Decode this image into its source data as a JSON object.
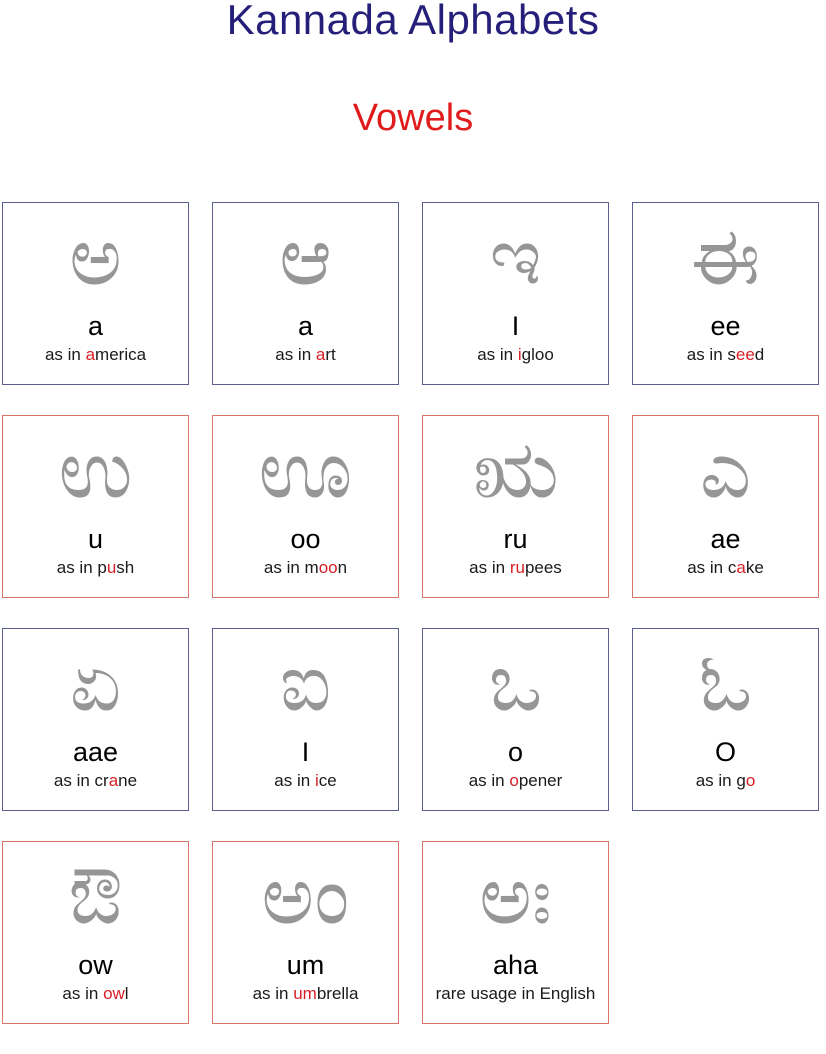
{
  "header": {
    "title": "Kannada Alphabets",
    "subtitle": "Vowels",
    "title_color": "#251f7a",
    "subtitle_color": "#e01b1b"
  },
  "colors": {
    "glyph_gray": "#969696",
    "border_navy": "#5a5f8f",
    "border_red": "#d9766b",
    "highlight_red": "#d81f26",
    "text_black": "#000000",
    "background": "#ffffff"
  },
  "chart_data": {
    "type": "table",
    "title": "Kannada Alphabets",
    "subtitle": "Vowels",
    "columns": 4,
    "rows": 4,
    "cells": 15
  },
  "rows": [
    {
      "border": "navy",
      "cells": [
        {
          "glyph": "ಅ",
          "roman": "a",
          "example_pre": "as in ",
          "example_hl": "a",
          "example_post": "merica"
        },
        {
          "glyph": "ಆ",
          "roman": "a",
          "example_pre": "as in ",
          "example_hl": "a",
          "example_post": "rt"
        },
        {
          "glyph": "ಇ",
          "roman": "I",
          "example_pre": "as in ",
          "example_hl": "i",
          "example_post": "gloo"
        },
        {
          "glyph": "ಈ",
          "roman": "ee",
          "example_pre": "as in s",
          "example_hl": "ee",
          "example_post": "d"
        }
      ]
    },
    {
      "border": "red",
      "cells": [
        {
          "glyph": "ಉ",
          "roman": "u",
          "example_pre": "as in p",
          "example_hl": "u",
          "example_post": "sh"
        },
        {
          "glyph": "ಊ",
          "roman": "oo",
          "example_pre": "as in m",
          "example_hl": "oo",
          "example_post": "n"
        },
        {
          "glyph": "ಋ",
          "roman": "ru",
          "example_pre": "as in ",
          "example_hl": "ru",
          "example_post": "pees"
        },
        {
          "glyph": "ಎ",
          "roman": "ae",
          "example_pre": "as in c",
          "example_hl": "a",
          "example_post": "ke"
        }
      ]
    },
    {
      "border": "navy",
      "cells": [
        {
          "glyph": "ಏ",
          "roman": "aae",
          "example_pre": "as in cr",
          "example_hl": "a",
          "example_post": "ne"
        },
        {
          "glyph": "ಐ",
          "roman": "I",
          "example_pre": "as in ",
          "example_hl": "i",
          "example_post": "ce"
        },
        {
          "glyph": "ಒ",
          "roman": "o",
          "example_pre": "as in ",
          "example_hl": "o",
          "example_post": "pener"
        },
        {
          "glyph": "ಓ",
          "roman": "O",
          "example_pre": "as in g",
          "example_hl": "o",
          "example_post": ""
        }
      ]
    },
    {
      "border": "red",
      "cells": [
        {
          "glyph": "ಔ",
          "roman": "ow",
          "example_pre": "as in ",
          "example_hl": "ow",
          "example_post": "l"
        },
        {
          "glyph": "ಅಂ",
          "roman": "um",
          "example_pre": "as in ",
          "example_hl": "um",
          "example_post": "brella"
        },
        {
          "glyph": "ಅಃ",
          "roman": "aha",
          "example_pre": "rare usage in English",
          "example_hl": "",
          "example_post": ""
        }
      ]
    }
  ]
}
